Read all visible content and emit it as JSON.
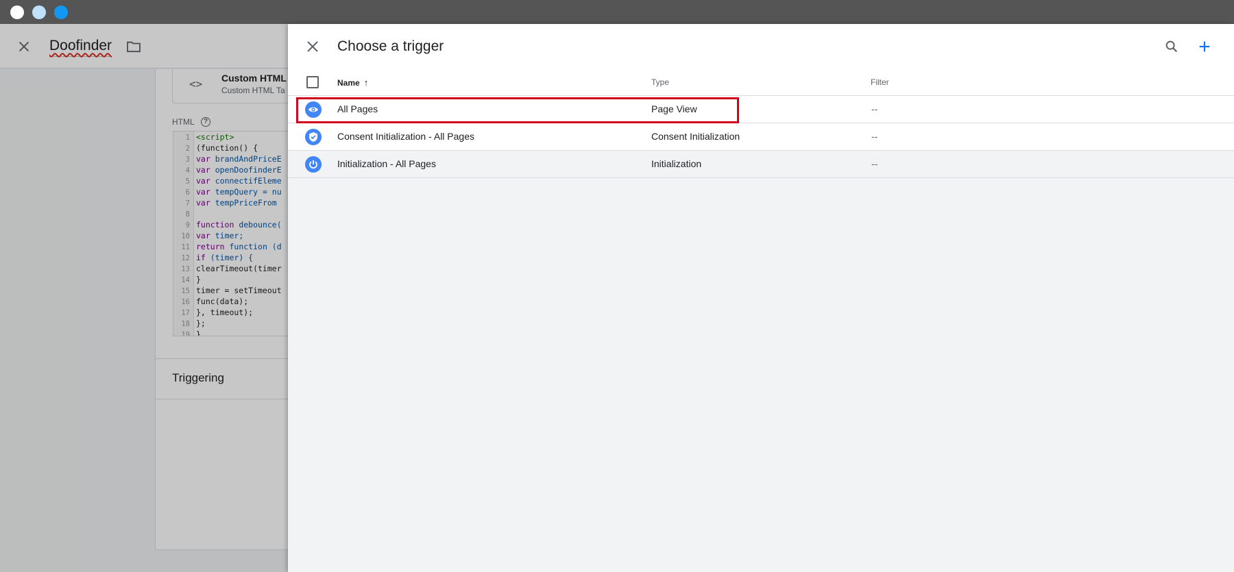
{
  "window": {
    "buttons": [
      "close-dot",
      "minimize-dot",
      "zoom-dot"
    ]
  },
  "background": {
    "tag_name": "Doofinder",
    "tag_type_name": "Custom HTML",
    "tag_type_sub": "Custom HTML Ta",
    "html_label": "HTML",
    "help_glyph": "?",
    "code_icon_glyph": "<>",
    "code_lines": [
      {
        "n": "1",
        "t": "<script>"
      },
      {
        "n": "2",
        "t": "(function() {"
      },
      {
        "n": "3",
        "t": "var brandAndPriceE"
      },
      {
        "n": "4",
        "t": "var openDoofinderE"
      },
      {
        "n": "5",
        "t": "var connectifEleme"
      },
      {
        "n": "6",
        "t": "var tempQuery = nu"
      },
      {
        "n": "7",
        "t": "var tempPriceFrom"
      },
      {
        "n": "8",
        "t": ""
      },
      {
        "n": "9",
        "t": "function debounce("
      },
      {
        "n": "10",
        "t": "var timer;"
      },
      {
        "n": "11",
        "t": "return function (d"
      },
      {
        "n": "12",
        "t": "if (timer) {"
      },
      {
        "n": "13",
        "t": "clearTimeout(timer"
      },
      {
        "n": "14",
        "t": "}"
      },
      {
        "n": "15",
        "t": "timer = setTimeout"
      },
      {
        "n": "16",
        "t": "func(data);"
      },
      {
        "n": "17",
        "t": "}, timeout);"
      },
      {
        "n": "18",
        "t": "};"
      },
      {
        "n": "19",
        "t": "}"
      }
    ],
    "triggering_title": "Triggering"
  },
  "panel": {
    "title": "Choose a trigger",
    "columns": {
      "name": "Name",
      "sort_glyph": "↑",
      "type": "Type",
      "filter": "Filter"
    },
    "rows": [
      {
        "name": "All Pages",
        "type": "Page View",
        "filter": "--",
        "icon": "eye-icon"
      },
      {
        "name": "Consent Initialization - All Pages",
        "type": "Consent Initialization",
        "filter": "--",
        "icon": "shield-icon"
      },
      {
        "name": "Initialization - All Pages",
        "type": "Initialization",
        "filter": "--",
        "icon": "power-icon"
      }
    ],
    "highlighted_row": 0
  },
  "colors": {
    "accent": "#1a73e8",
    "row_icon_bg": "#4285f4",
    "highlight": "#d0021b",
    "chrome": "#555555"
  }
}
